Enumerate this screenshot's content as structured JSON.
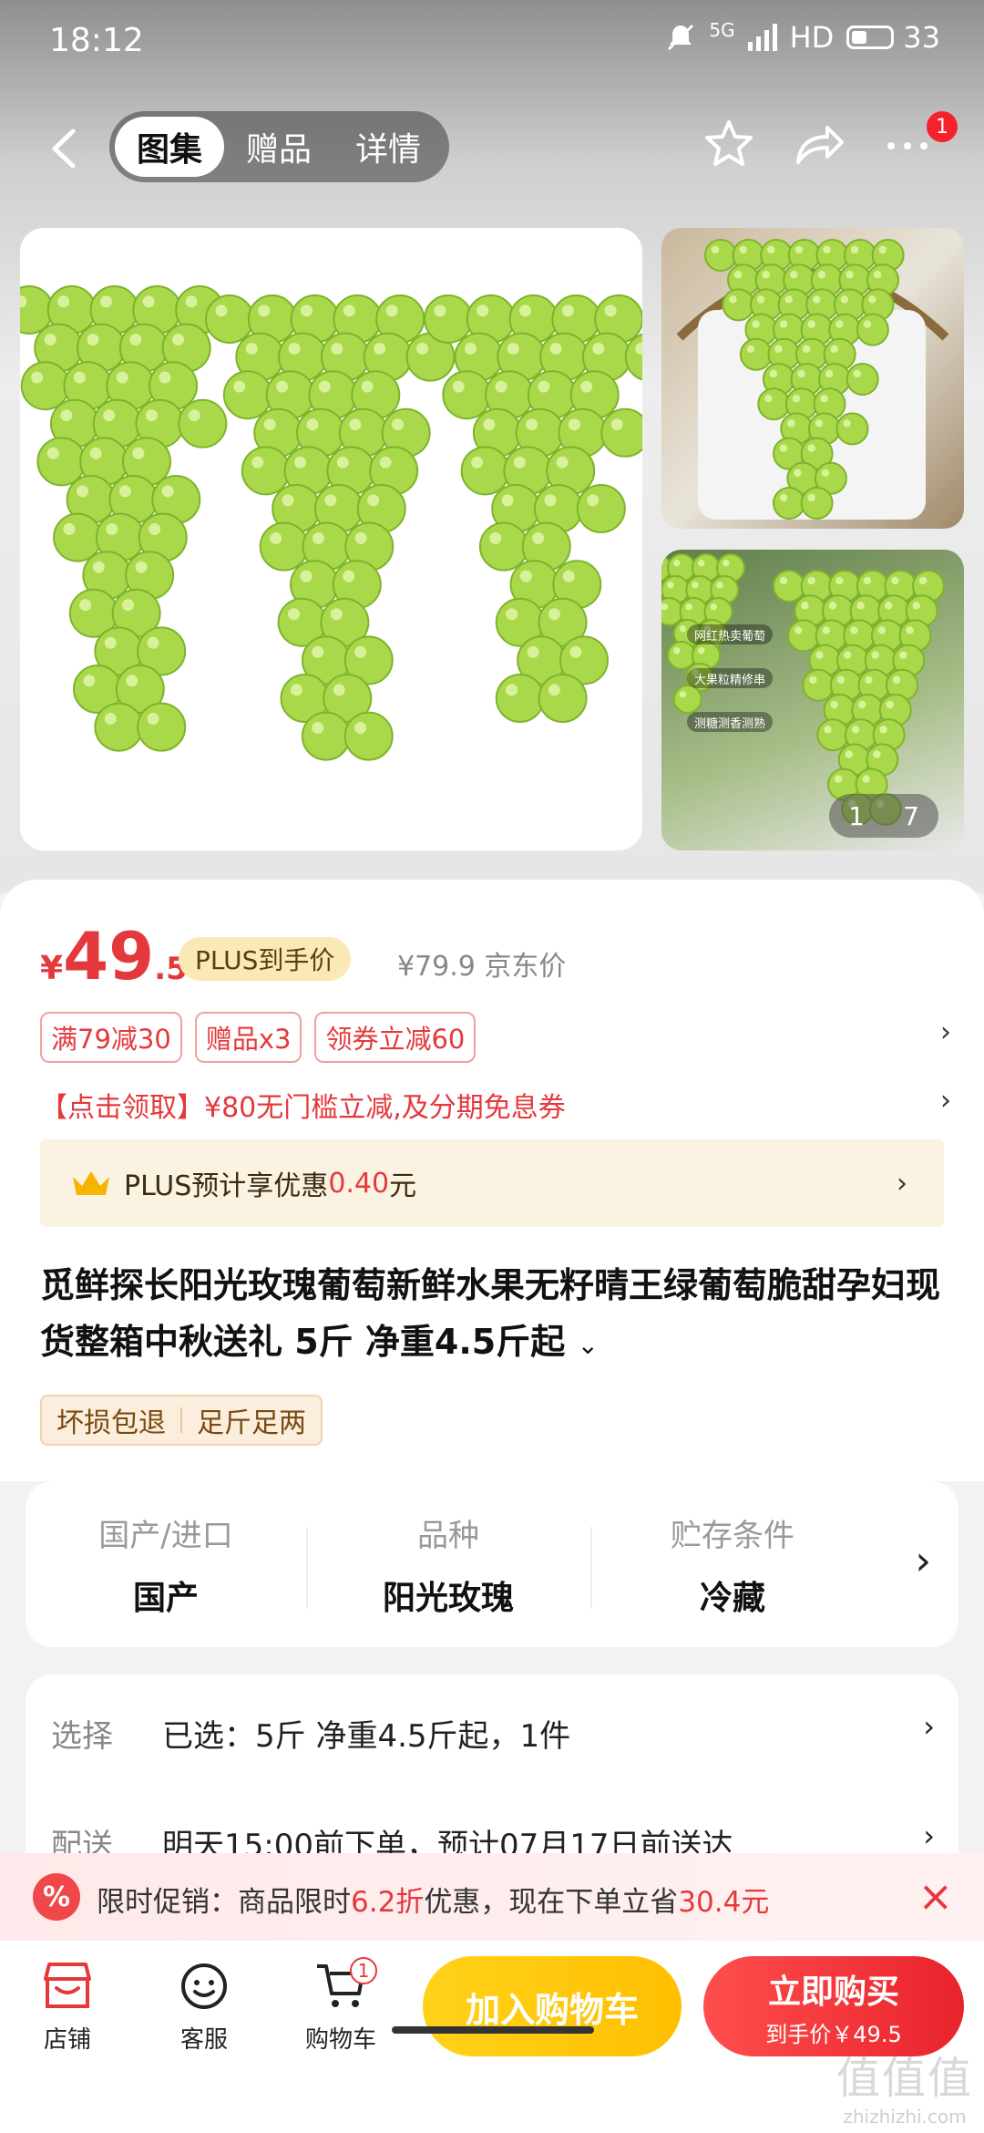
{
  "status_bar": {
    "time": "18:12",
    "network": "5G",
    "hd": "HD",
    "battery": "33"
  },
  "nav": {
    "tabs": [
      {
        "label": "图集",
        "active": true
      },
      {
        "label": "赠品",
        "active": false
      },
      {
        "label": "详情",
        "active": false
      }
    ],
    "more_badge": "1"
  },
  "gallery": {
    "page_current": "1",
    "page_total": "7",
    "thumb2_tags": [
      "网红热卖葡萄",
      "大果粒精修串",
      "测糖测香测熟"
    ]
  },
  "price": {
    "symbol": "¥",
    "integer": "49",
    "decimal": ".5",
    "plus_tag": "PLUS到手价",
    "original": "¥79.9 京东价"
  },
  "promos": {
    "tags": [
      "满79减30",
      "赠品x3",
      "领券立减60"
    ],
    "coupon_text": "【点击领取】¥80无门槛立减,及分期免息券"
  },
  "plus_bar": {
    "prefix": "PLUS预计享优惠",
    "amount": "0.40",
    "suffix": "元"
  },
  "product": {
    "title": "觅鲜探长阳光玫瑰葡萄新鲜水果无籽晴王绿葡萄脆甜孕妇现货整箱中秋送礼 5斤 净重4.5斤起",
    "service_tags": [
      "坏损包退",
      "足斤足两"
    ]
  },
  "specs": [
    {
      "label": "国产/进口",
      "value": "国产"
    },
    {
      "label": "品种",
      "value": "阳光玫瑰"
    },
    {
      "label": "贮存条件",
      "value": "冷藏"
    }
  ],
  "selection": {
    "select_label": "选择",
    "select_value": "已选：5斤 净重4.5斤起，1件",
    "delivery_label": "配送",
    "delivery_value": "明天15:00前下单，预计07月17日前送达"
  },
  "promo_banner": {
    "icon": "%",
    "text_a": "限时促销：商品限时",
    "discount": "6.2折",
    "text_b": "优惠，现在下单立省",
    "save": "30.4元"
  },
  "bottom_bar": {
    "shop": "店铺",
    "service": "客服",
    "cart": "购物车",
    "cart_count": "1",
    "add_to_cart": "加入购物车",
    "buy_now": "立即购买",
    "buy_price": "到手价￥49.5"
  },
  "watermark": {
    "big": "值值值",
    "small": "zhizhizhi.com"
  },
  "colors": {
    "accent_red": "#e4393c",
    "cart_yellow": "#ffc700",
    "plus_gold": "#fbe9b5"
  }
}
